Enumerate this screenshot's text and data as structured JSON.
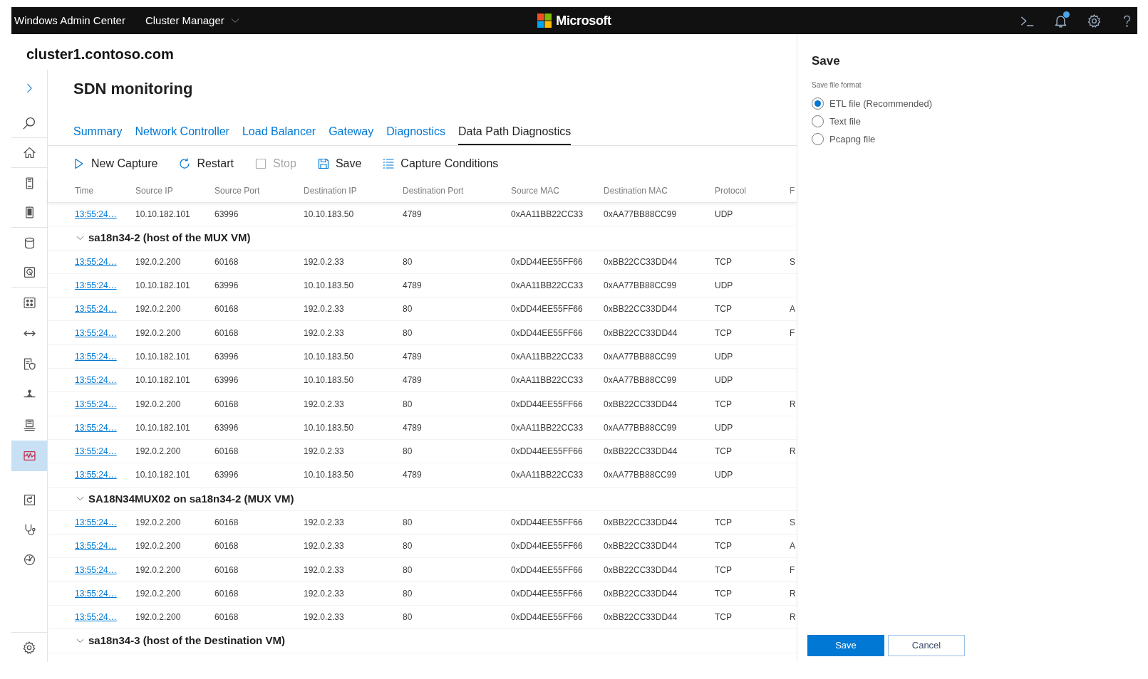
{
  "top_bar": {
    "app_title": "Windows Admin Center",
    "context_menu": {
      "label": "Cluster Manager"
    },
    "brand": "Microsoft",
    "notifications": {
      "unread": true
    }
  },
  "connection_title": "cluster1.contoso.com",
  "sidebar": {
    "items": [
      {
        "selected": false
      },
      {
        "selected": false
      },
      {
        "selected": false
      },
      {
        "selected": false
      },
      {
        "selected": false
      },
      {
        "selected": false
      },
      {
        "selected": false
      },
      {
        "selected": false
      },
      {
        "selected": false
      },
      {
        "selected": false
      },
      {
        "selected": true
      },
      {
        "selected": false
      },
      {
        "selected": false
      },
      {
        "selected": false
      }
    ]
  },
  "page_title": "SDN monitoring",
  "tabs": [
    {
      "label": "Summary",
      "selected": false
    },
    {
      "label": "Network Controller",
      "selected": false
    },
    {
      "label": "Load Balancer",
      "selected": false
    },
    {
      "label": "Gateway",
      "selected": false
    },
    {
      "label": "Diagnostics",
      "selected": false
    },
    {
      "label": "Data Path Diagnostics",
      "selected": true
    }
  ],
  "toolbar": [
    {
      "label": "New Capture",
      "disabled": false
    },
    {
      "label": "Restart",
      "disabled": false
    },
    {
      "label": "Stop",
      "disabled": true
    },
    {
      "label": "Save",
      "disabled": false
    },
    {
      "label": "Capture Conditions",
      "disabled": false
    }
  ],
  "table": {
    "columns": [
      "Time",
      "Source IP",
      "Source Port",
      "Destination IP",
      "Destination Port",
      "Source MAC",
      "Destination MAC",
      "Protocol",
      "F"
    ],
    "items": [
      {
        "kind": "row",
        "cells": [
          "13:55:24…",
          "10.10.182.101",
          "63996",
          "10.10.183.50",
          "4789",
          "0xAA11BB22CC33",
          "0xAA77BB88CC99",
          "UDP"
        ]
      },
      {
        "kind": "group",
        "label": "sa18n34-2 (host of the MUX VM)",
        "expanded": true,
        "children": [
          {
            "kind": "row",
            "cells": [
              "13:55:24…",
              "192.0.2.200",
              "60168",
              "192.0.2.33",
              "80",
              "0xDD44EE55FF66",
              "0xBB22CC33DD44",
              "TCP",
              "S"
            ]
          },
          {
            "kind": "row",
            "cells": [
              "13:55:24…",
              "10.10.182.101",
              "63996",
              "10.10.183.50",
              "4789",
              "0xAA11BB22CC33",
              "0xAA77BB88CC99",
              "UDP"
            ]
          },
          {
            "kind": "row",
            "cells": [
              "13:55:24…",
              "192.0.2.200",
              "60168",
              "192.0.2.33",
              "80",
              "0xDD44EE55FF66",
              "0xBB22CC33DD44",
              "TCP",
              "A"
            ]
          },
          {
            "kind": "row",
            "cells": [
              "13:55:24…",
              "192.0.2.200",
              "60168",
              "192.0.2.33",
              "80",
              "0xDD44EE55FF66",
              "0xBB22CC33DD44",
              "TCP",
              "F"
            ]
          },
          {
            "kind": "row",
            "cells": [
              "13:55:24…",
              "10.10.182.101",
              "63996",
              "10.10.183.50",
              "4789",
              "0xAA11BB22CC33",
              "0xAA77BB88CC99",
              "UDP"
            ]
          },
          {
            "kind": "row",
            "cells": [
              "13:55:24…",
              "10.10.182.101",
              "63996",
              "10.10.183.50",
              "4789",
              "0xAA11BB22CC33",
              "0xAA77BB88CC99",
              "UDP"
            ]
          },
          {
            "kind": "row",
            "cells": [
              "13:55:24…",
              "192.0.2.200",
              "60168",
              "192.0.2.33",
              "80",
              "0xDD44EE55FF66",
              "0xBB22CC33DD44",
              "TCP",
              "R"
            ]
          },
          {
            "kind": "row",
            "cells": [
              "13:55:24…",
              "10.10.182.101",
              "63996",
              "10.10.183.50",
              "4789",
              "0xAA11BB22CC33",
              "0xAA77BB88CC99",
              "UDP"
            ]
          },
          {
            "kind": "row",
            "cells": [
              "13:55:24…",
              "192.0.2.200",
              "60168",
              "192.0.2.33",
              "80",
              "0xDD44EE55FF66",
              "0xBB22CC33DD44",
              "TCP",
              "R"
            ]
          },
          {
            "kind": "row",
            "cells": [
              "13:55:24…",
              "10.10.182.101",
              "63996",
              "10.10.183.50",
              "4789",
              "0xAA11BB22CC33",
              "0xAA77BB88CC99",
              "UDP"
            ]
          }
        ]
      },
      {
        "kind": "group",
        "label": "SA18N34MUX02 on sa18n34-2 (MUX VM)",
        "expanded": true,
        "children": [
          {
            "kind": "row",
            "cells": [
              "13:55:24…",
              "192.0.2.200",
              "60168",
              "192.0.2.33",
              "80",
              "0xDD44EE55FF66",
              "0xBB22CC33DD44",
              "TCP",
              "S"
            ]
          },
          {
            "kind": "row",
            "cells": [
              "13:55:24…",
              "192.0.2.200",
              "60168",
              "192.0.2.33",
              "80",
              "0xDD44EE55FF66",
              "0xBB22CC33DD44",
              "TCP",
              "A"
            ]
          },
          {
            "kind": "row",
            "cells": [
              "13:55:24…",
              "192.0.2.200",
              "60168",
              "192.0.2.33",
              "80",
              "0xDD44EE55FF66",
              "0xBB22CC33DD44",
              "TCP",
              "F"
            ]
          },
          {
            "kind": "row",
            "cells": [
              "13:55:24…",
              "192.0.2.200",
              "60168",
              "192.0.2.33",
              "80",
              "0xDD44EE55FF66",
              "0xBB22CC33DD44",
              "TCP",
              "R"
            ]
          },
          {
            "kind": "row",
            "cells": [
              "13:55:24…",
              "192.0.2.200",
              "60168",
              "192.0.2.33",
              "80",
              "0xDD44EE55FF66",
              "0xBB22CC33DD44",
              "TCP",
              "R"
            ]
          }
        ]
      },
      {
        "kind": "group",
        "label": "sa18n34-3 (host of the Destination VM)",
        "expanded": true
      }
    ]
  },
  "save_panel": {
    "title": "Save",
    "field_label": "Save file format",
    "options": [
      {
        "label": "ETL file (Recommended)",
        "selected": true
      },
      {
        "label": "Text file",
        "selected": false
      },
      {
        "label": "Pcapng file",
        "selected": false
      }
    ],
    "buttons": [
      {
        "label": "Save",
        "kind": "primary"
      },
      {
        "label": "Cancel",
        "kind": "secondary"
      }
    ]
  }
}
